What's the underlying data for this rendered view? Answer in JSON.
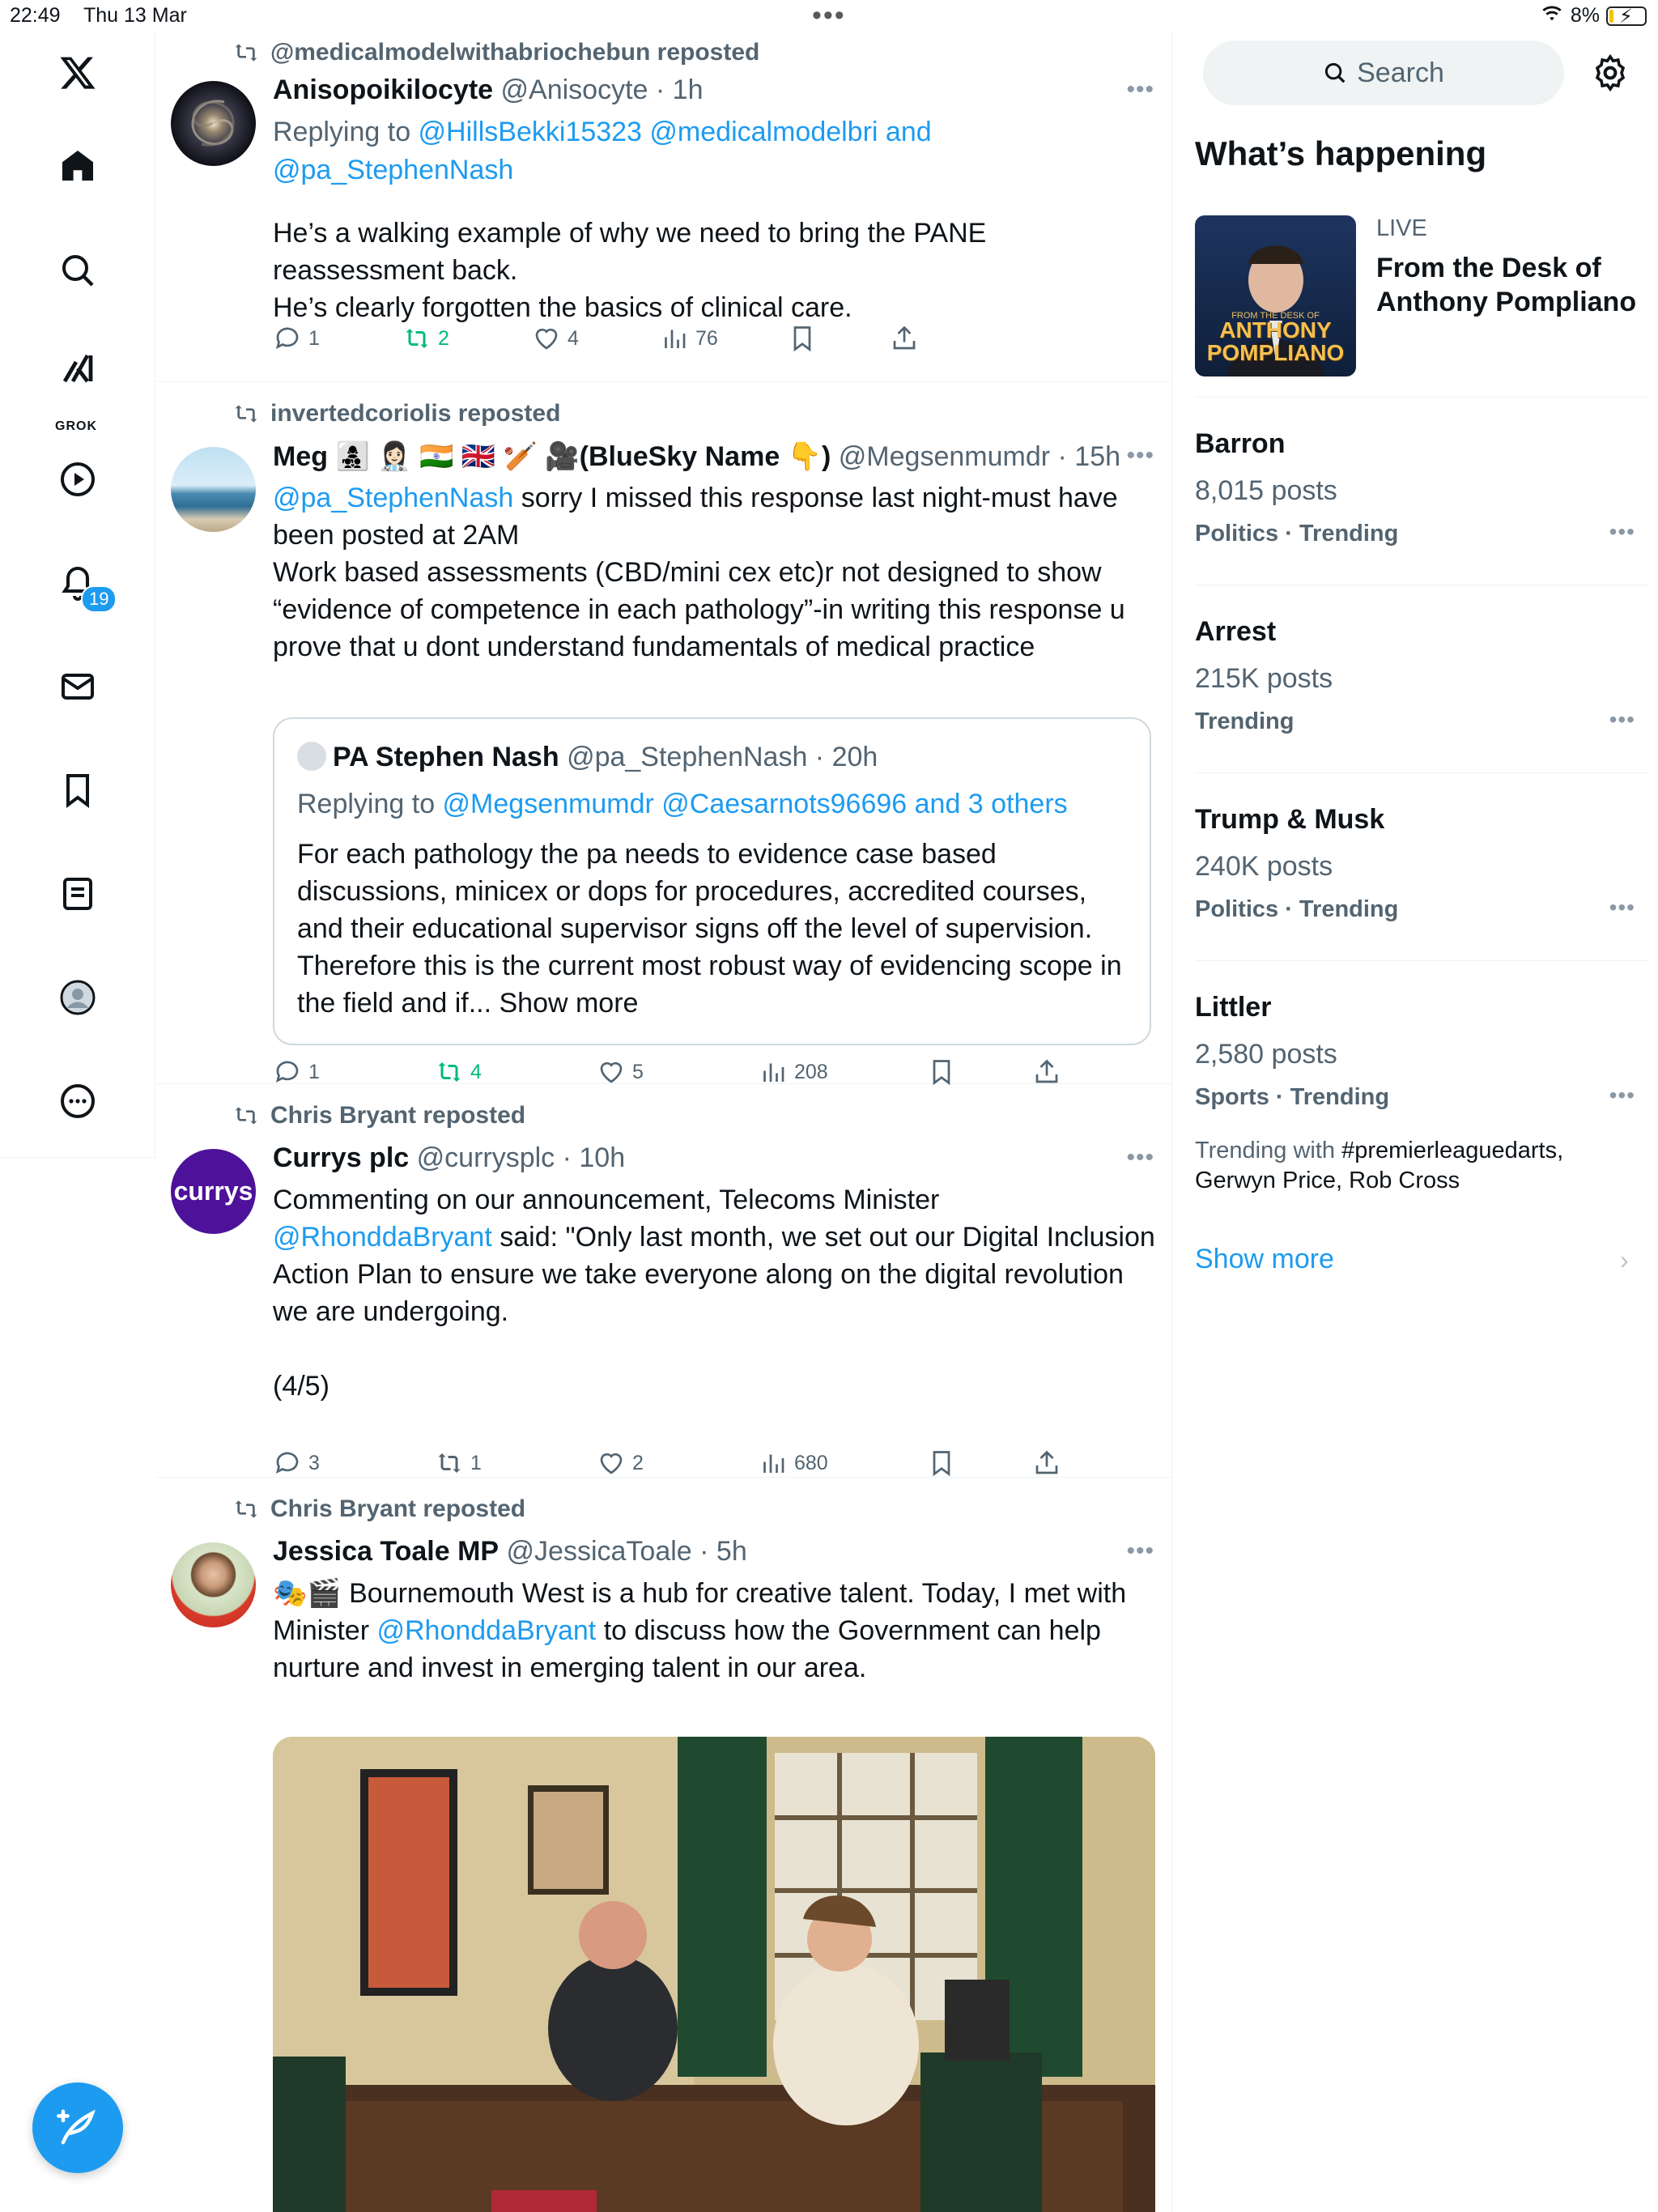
{
  "status_bar": {
    "time": "22:49",
    "date": "Thu 13 Mar",
    "battery": "8%"
  },
  "nav": {
    "notifications_count": "19",
    "grok_label": "GROK"
  },
  "posts": [
    {
      "repost_by": "@medicalmodelwithabriochebun reposted",
      "name": "Anisopoikilocyte",
      "handle": "@Anisocyte",
      "time": "1h",
      "replying_prefix": "Replying to ",
      "replying_line1": "@HillsBekki15323 @medicalmodelbri and",
      "replying_line2": "@pa_StephenNash",
      "text": "He’s a walking example of why we need to bring the PANE\nreassessment back.\nHe’s clearly forgotten the basics of clinical care.",
      "stats": {
        "replies": "1",
        "reposts": "2",
        "likes": "4",
        "views": "76"
      }
    },
    {
      "repost_by": "invertedcoriolis reposted",
      "name": "Meg 👩‍👧‍👦 👩🏻‍⚕️ 🇮🇳 🇬🇧 🏏 🎥(BlueSky Name 👇)",
      "handle": "@Megsenmumdr",
      "time": "15h",
      "mention": "@pa_StephenNash",
      "text_after_mention": " sorry I missed this response last night-must have been posted at 2AM\nWork based assessments (CBD/mini cex etc)r not designed to show “evidence of competence in each pathology”-in writing this response u prove that u dont understand fundamentals of medical practice",
      "quote": {
        "name": "PA Stephen Nash",
        "handle": "@pa_StephenNash",
        "time": "20h",
        "replying_prefix": "Replying to ",
        "replying_to": "@Megsenmumdr @Caesarnots96696 and 3 others",
        "text": "For each pathology the pa needs to evidence case based discussions, minicex or dops for procedures, accredited courses, and their educational supervisor signs off the level of supervision. Therefore this is the current most robust way of evidencing scope in the field and if... Show more"
      },
      "stats": {
        "replies": "1",
        "reposts": "4",
        "likes": "5",
        "views": "208"
      }
    },
    {
      "repost_by": "Chris Bryant reposted",
      "name": "Currys plc",
      "handle": "@currysplc",
      "time": "10h",
      "avatar_text": "currys",
      "text_before": "Commenting on our announcement, Telecoms Minister\n",
      "mention": "@RhonddaBryant",
      "text_after": " said: \"Only last month, we set out our Digital Inclusion Action Plan to ensure we take everyone along on the digital revolution we are undergoing.\n\n(4/5)",
      "stats": {
        "replies": "3",
        "reposts": "1",
        "likes": "2",
        "views": "680"
      }
    },
    {
      "repost_by": "Chris Bryant reposted",
      "name": "Jessica Toale MP",
      "handle": "@JessicaToale",
      "time": "5h",
      "text_before": "🎭🎬 Bournemouth West is a hub for creative talent. Today, I met with Minister ",
      "mention": "@RhonddaBryant",
      "text_after": " to discuss how the Government can help nurture and invest in emerging talent in our area."
    }
  ],
  "sidebar": {
    "search_placeholder": "Search",
    "heading": "What’s happening",
    "live": {
      "tag": "LIVE",
      "title": "From the Desk of Anthony Pompliano",
      "thumb_small": "FROM THE DESK OF",
      "thumb_line1": "ANTHONY",
      "thumb_line2": "POMPLIANO"
    },
    "trends": [
      {
        "name": "Barron",
        "count": "8,015 posts",
        "category": "Politics · Trending"
      },
      {
        "name": "Arrest",
        "count": "215K posts",
        "category": "Trending"
      },
      {
        "name": "Trump & Musk",
        "count": "240K posts",
        "category": "Politics · Trending"
      },
      {
        "name": "Littler",
        "count": "2,580 posts",
        "category": "Sports · Trending",
        "with_prefix": "Trending with ",
        "with_tags": "#premierleaguedarts,",
        "with_rest": "Gerwyn Price, Rob Cross"
      }
    ],
    "show_more": "Show more"
  },
  "colors": {
    "accent": "#1d9bf0",
    "repost_green": "#00ba7c",
    "currys_purple": "#4d1299"
  }
}
